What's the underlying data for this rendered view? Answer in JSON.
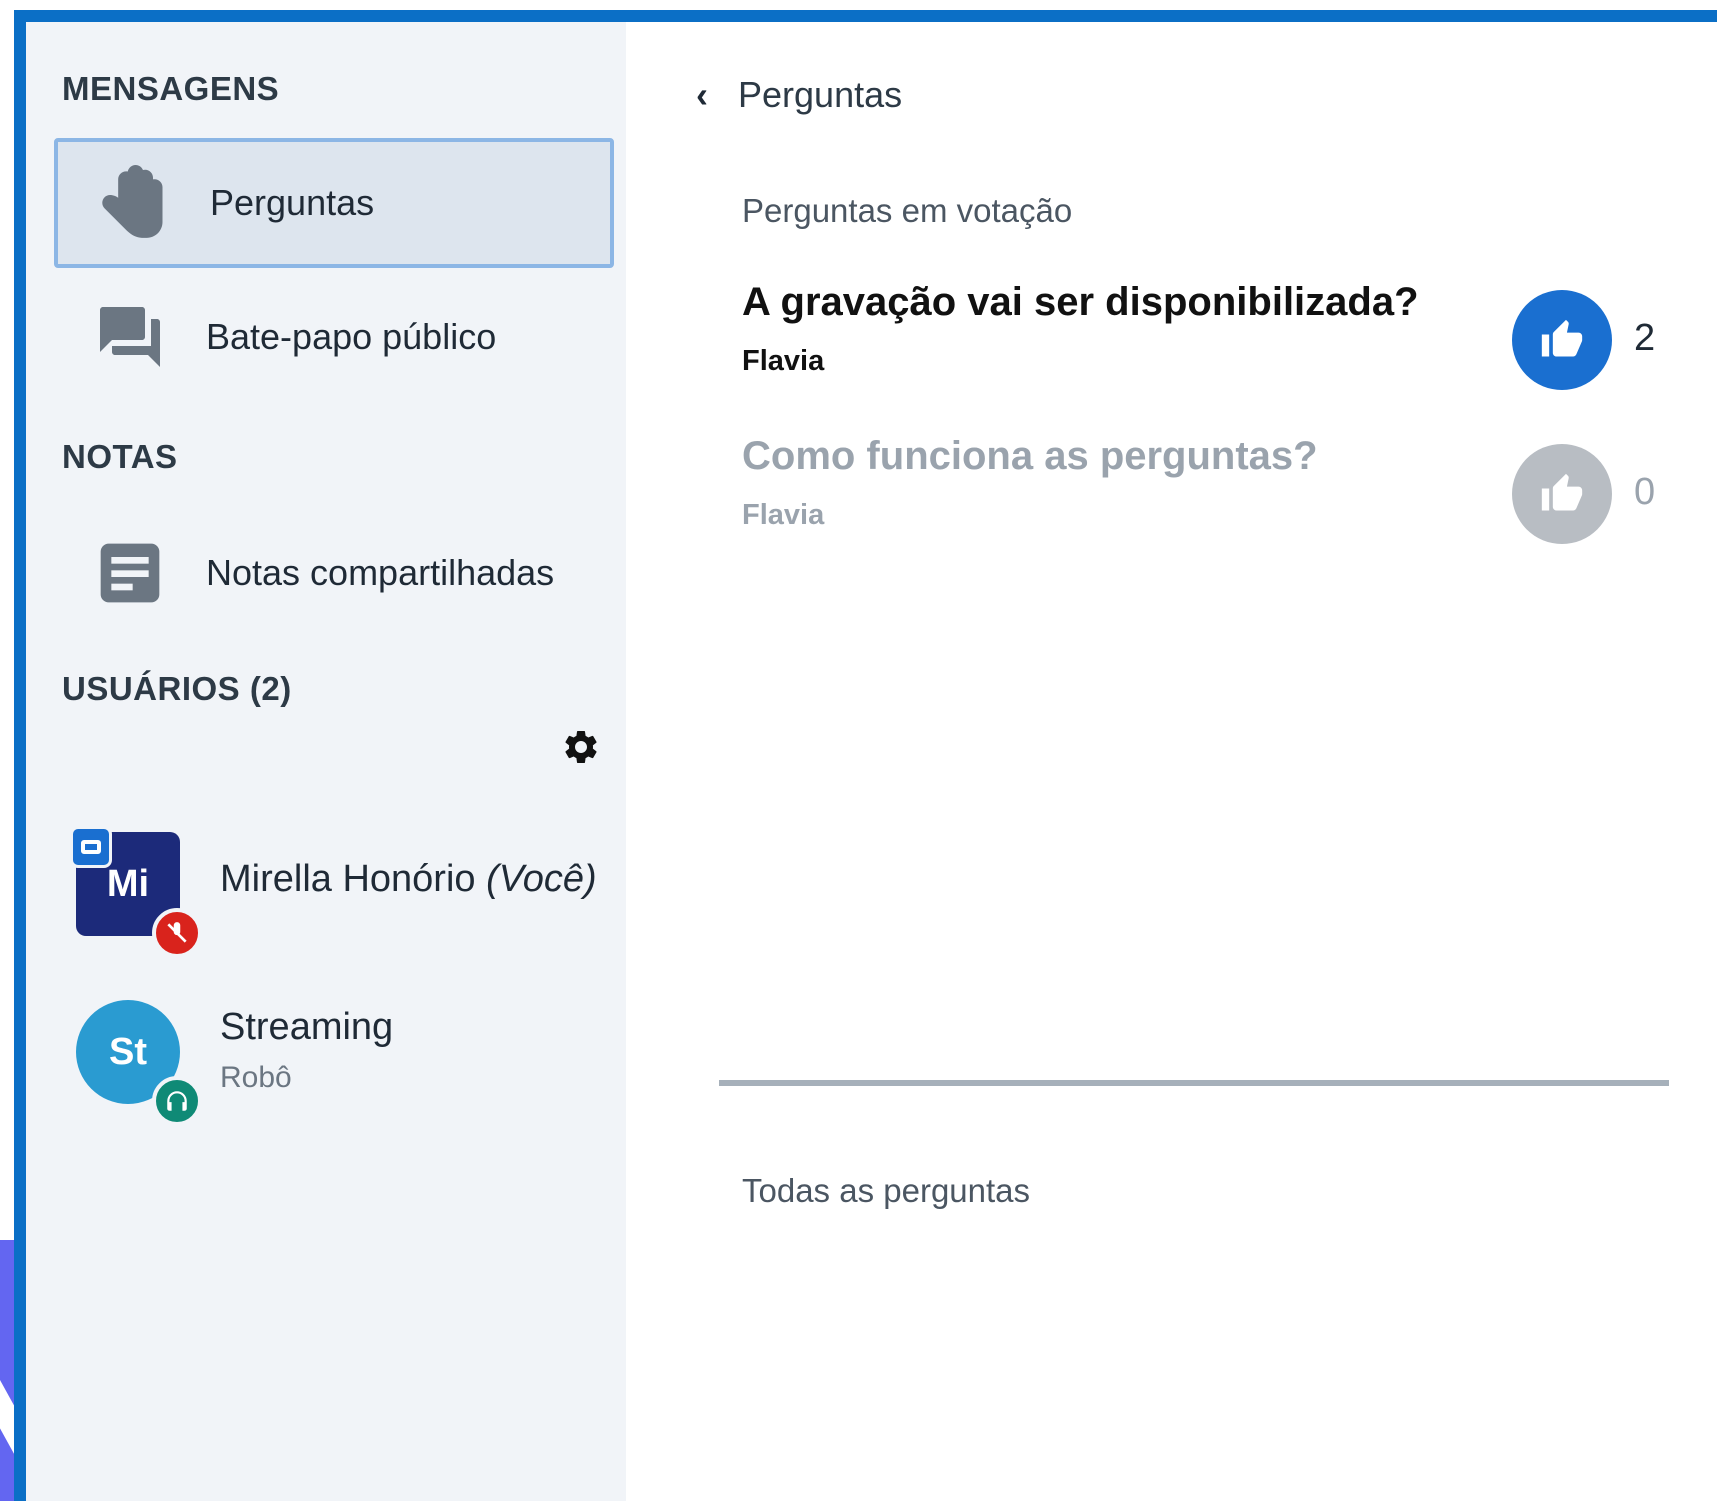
{
  "sidebar": {
    "messages_title": "MENSAGENS",
    "items": [
      {
        "label": "Perguntas",
        "icon": "hand-icon",
        "active": true
      },
      {
        "label": "Bate-papo público",
        "icon": "chat-icon",
        "active": false
      }
    ],
    "notes_title": "NOTAS",
    "notes_item": {
      "label": "Notas compartilhadas",
      "icon": "notes-icon"
    },
    "users_title": "USUÁRIOS (2)",
    "users": [
      {
        "initials": "Mi",
        "name": "Mirella Honório",
        "you_tag": "(Você)",
        "role": "",
        "avatar_color": "#1c2a7a"
      },
      {
        "initials": "St",
        "name": "Streaming",
        "you_tag": "",
        "role": "Robô",
        "avatar_color": "#2a9bd1"
      }
    ]
  },
  "main": {
    "back_title": "Perguntas",
    "voting_title": "Perguntas em votação",
    "questions": [
      {
        "text": "A gravação vai ser disponibilizada?",
        "author": "Flavia",
        "votes": "2",
        "voted": true
      },
      {
        "text": "Como funciona as perguntas?",
        "author": "Flavia",
        "votes": "0",
        "voted": false
      }
    ],
    "all_title": "Todas as perguntas"
  },
  "colors": {
    "accent": "#1a6fd0",
    "frame": "#0b6fc6",
    "sidebar_bg": "#f1f4f8"
  }
}
